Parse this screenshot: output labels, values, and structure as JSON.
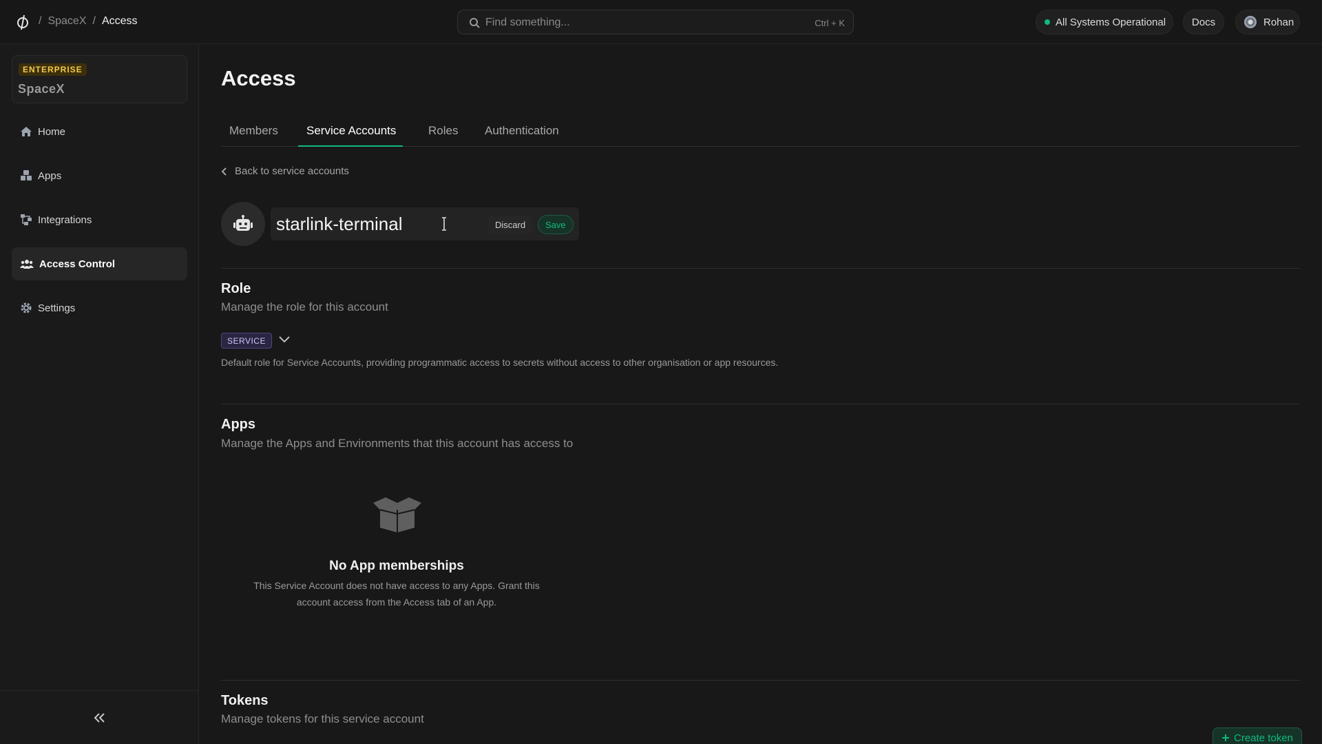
{
  "topbar": {
    "breadcrumb": [
      "SpaceX",
      "Access"
    ],
    "separator": "/",
    "search_placeholder": "Find something...",
    "search_shortcut": "Ctrl + K",
    "status_label": "All Systems Operational",
    "status_color": "#10b981",
    "docs_label": "Docs",
    "user_name": "Rohan"
  },
  "sidebar": {
    "plan_badge": "ENTERPRISE",
    "org_name": "SpaceX",
    "items": [
      {
        "label": "Home",
        "icon": "home-icon"
      },
      {
        "label": "Apps",
        "icon": "cubes-icon"
      },
      {
        "label": "Integrations",
        "icon": "integrations-icon"
      },
      {
        "label": "Access Control",
        "icon": "users-icon",
        "active": true
      },
      {
        "label": "Settings",
        "icon": "gear-icon"
      }
    ],
    "collapse_icon": "chevrons-left-icon"
  },
  "page": {
    "title": "Access",
    "tabs": [
      "Members",
      "Service Accounts",
      "Roles",
      "Authentication"
    ],
    "active_tab": "Service Accounts",
    "back_link": "Back to service accounts",
    "account_name": "starlink-terminal",
    "discard_label": "Discard",
    "save_label": "Save"
  },
  "role": {
    "title": "Role",
    "subtitle": "Manage the role for this account",
    "badge": "SERVICE",
    "description": "Default role for Service Accounts, providing programmatic access to secrets without access to other organisation or app resources."
  },
  "apps": {
    "title": "Apps",
    "subtitle": "Manage the Apps and Environments that this account has access to",
    "empty_title": "No App memberships",
    "empty_description": "This Service Account does not have access to any Apps. Grant this account access from the Access tab of an App."
  },
  "tokens": {
    "title": "Tokens",
    "subtitle": "Manage tokens for this service account",
    "create_label": "Create token"
  },
  "colors": {
    "accent": "#10b981",
    "enterprise": "#f2c94c",
    "role_badge": "#cfc6ff"
  }
}
